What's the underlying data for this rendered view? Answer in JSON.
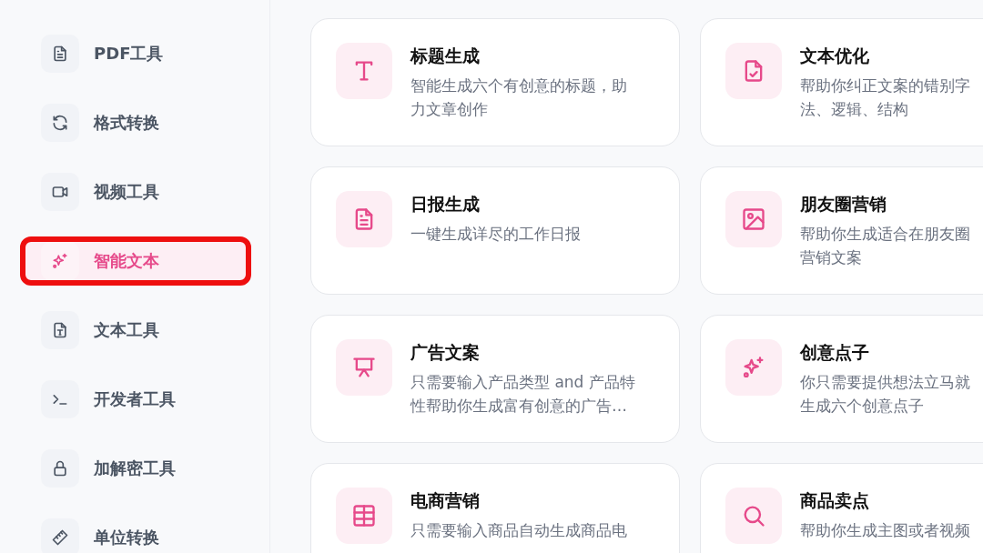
{
  "sidebar": {
    "items": [
      {
        "label": "PDF工具",
        "selected": false
      },
      {
        "label": "格式转换",
        "selected": false
      },
      {
        "label": "视频工具",
        "selected": false
      },
      {
        "label": "智能文本",
        "selected": true
      },
      {
        "label": "文本工具",
        "selected": false
      },
      {
        "label": "开发者工具",
        "selected": false
      },
      {
        "label": "加解密工具",
        "selected": false
      },
      {
        "label": "单位转换",
        "selected": false
      }
    ]
  },
  "cards": [
    {
      "title": "标题生成",
      "lines": [
        "智能生成六个有创意的标题，助",
        "力文章创作"
      ]
    },
    {
      "title": "文本优化",
      "lines": [
        "帮助你纠正文案的错别字",
        "法、逻辑、结构"
      ]
    },
    {
      "title": "日报生成",
      "lines": [
        "一键生成详尽的工作日报"
      ]
    },
    {
      "title": "朋友圈营销",
      "lines": [
        "帮助你生成适合在朋友圈",
        "营销文案"
      ]
    },
    {
      "title": "广告文案",
      "lines": [
        "只需要输入产品类型 and 产品特",
        "性帮助你生成富有创意的广告…"
      ]
    },
    {
      "title": "创意点子",
      "lines": [
        "你只需要提供想法立马就",
        "生成六个创意点子"
      ]
    },
    {
      "title": "电商营销",
      "lines": [
        "只需要输入商品自动生成商品电"
      ]
    },
    {
      "title": "商品卖点",
      "lines": [
        "帮助你生成主图或者视频"
      ]
    }
  ]
}
